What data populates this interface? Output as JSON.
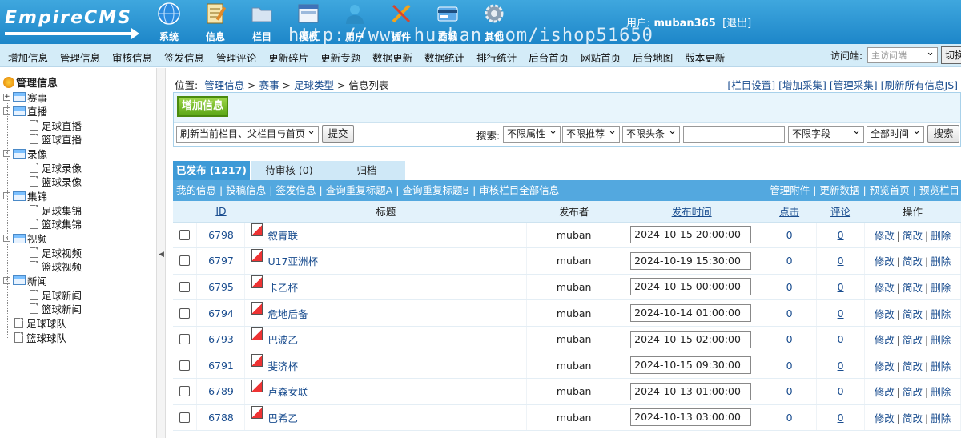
{
  "header": {
    "logo": "EmpireCMS",
    "nav": [
      {
        "label": "系统",
        "icon": "globe-icon"
      },
      {
        "label": "信息",
        "icon": "notepad-icon"
      },
      {
        "label": "栏目",
        "icon": "folder-icon"
      },
      {
        "label": "模板",
        "icon": "window-icon"
      },
      {
        "label": "用户",
        "icon": "user-icon"
      },
      {
        "label": "插件",
        "icon": "tools-icon"
      },
      {
        "label": "商城",
        "icon": "card-icon"
      },
      {
        "label": "其他",
        "icon": "gear-icon"
      }
    ],
    "watermark": "http://www.huzhan.com/ishop51650",
    "user_prefix": "用户:",
    "username": "muban365",
    "logout": "[退出]"
  },
  "subbar": {
    "links": [
      "增加信息",
      "管理信息",
      "审核信息",
      "签发信息",
      "管理评论",
      "更新碎片",
      "更新专题",
      "数据更新",
      "数据统计",
      "排行统计",
      "后台首页",
      "网站首页",
      "后台地图",
      "版本更新"
    ],
    "visit_label": "访问端:",
    "visit_value": "主访问端",
    "switch_button": "切换"
  },
  "tree": {
    "title": "管理信息",
    "nodes": [
      {
        "label": "赛事",
        "level": 0,
        "type": "folder",
        "expander": "+"
      },
      {
        "label": "直播",
        "level": 0,
        "type": "folder",
        "expander": "-"
      },
      {
        "label": "足球直播",
        "level": 1,
        "type": "doc"
      },
      {
        "label": "篮球直播",
        "level": 1,
        "type": "doc"
      },
      {
        "label": "录像",
        "level": 0,
        "type": "folder",
        "expander": "-"
      },
      {
        "label": "足球录像",
        "level": 1,
        "type": "doc"
      },
      {
        "label": "篮球录像",
        "level": 1,
        "type": "doc"
      },
      {
        "label": "集锦",
        "level": 0,
        "type": "folder",
        "expander": "-"
      },
      {
        "label": "足球集锦",
        "level": 1,
        "type": "doc"
      },
      {
        "label": "篮球集锦",
        "level": 1,
        "type": "doc"
      },
      {
        "label": "视频",
        "level": 0,
        "type": "folder",
        "expander": "-"
      },
      {
        "label": "足球视频",
        "level": 1,
        "type": "doc"
      },
      {
        "label": "篮球视频",
        "level": 1,
        "type": "doc"
      },
      {
        "label": "新闻",
        "level": 0,
        "type": "folder",
        "expander": "-"
      },
      {
        "label": "足球新闻",
        "level": 1,
        "type": "doc"
      },
      {
        "label": "篮球新闻",
        "level": 1,
        "type": "doc"
      },
      {
        "label": "足球球队",
        "level": 0,
        "type": "doc"
      },
      {
        "label": "篮球球队",
        "level": 0,
        "type": "doc"
      }
    ]
  },
  "breadcrumb": {
    "prefix": "位置:",
    "items": [
      "管理信息",
      "赛事",
      "足球类型"
    ],
    "current": "信息列表"
  },
  "top_links": [
    "[栏目设置]",
    "[增加采集]",
    "[管理采集]",
    "[刷新所有信息JS]"
  ],
  "add_button": "增加信息",
  "refresh_select": "刷新当前栏目、父栏目与首页",
  "submit_button": "提交",
  "search": {
    "label": "搜索:",
    "attr": "不限属性",
    "recommend": "不限推荐",
    "headline": "不限头条",
    "keyword": "",
    "field": "不限字段",
    "time": "全部时间",
    "button": "搜索"
  },
  "tabs": [
    "已发布 (1217)",
    "待审核 (0)",
    "归档"
  ],
  "info_links_left": [
    "我的信息",
    "投稿信息",
    "签发信息",
    "查询重复标题A",
    "查询重复标题B",
    "审核栏目全部信息"
  ],
  "info_links_right": [
    "管理附件",
    "更新数据",
    "预览首页",
    "预览栏目"
  ],
  "table": {
    "headers": {
      "id": "ID",
      "title": "标题",
      "publisher": "发布者",
      "time": "发布时间",
      "clicks": "点击",
      "comments": "评论",
      "ops": "操作"
    },
    "rows": [
      {
        "id": "6798",
        "title": "叙青联",
        "publisher": "muban",
        "time": "2024-10-15 20:00:00",
        "clicks": "0",
        "comments": "0"
      },
      {
        "id": "6797",
        "title": "U17亚洲杯",
        "publisher": "muban",
        "time": "2024-10-19 15:30:00",
        "clicks": "0",
        "comments": "0"
      },
      {
        "id": "6795",
        "title": "卡乙杯",
        "publisher": "muban",
        "time": "2024-10-15 00:00:00",
        "clicks": "0",
        "comments": "0"
      },
      {
        "id": "6794",
        "title": "危地后备",
        "publisher": "muban",
        "time": "2024-10-14 01:00:00",
        "clicks": "0",
        "comments": "0"
      },
      {
        "id": "6793",
        "title": "巴波乙",
        "publisher": "muban",
        "time": "2024-10-15 02:00:00",
        "clicks": "0",
        "comments": "0"
      },
      {
        "id": "6791",
        "title": "斐济杯",
        "publisher": "muban",
        "time": "2024-10-15 09:30:00",
        "clicks": "0",
        "comments": "0"
      },
      {
        "id": "6789",
        "title": "卢森女联",
        "publisher": "muban",
        "time": "2024-10-13 01:00:00",
        "clicks": "0",
        "comments": "0"
      },
      {
        "id": "6788",
        "title": "巴希乙",
        "publisher": "muban",
        "time": "2024-10-13 03:00:00",
        "clicks": "0",
        "comments": "0"
      }
    ],
    "ops": [
      "修改",
      "简改",
      "删除"
    ]
  }
}
